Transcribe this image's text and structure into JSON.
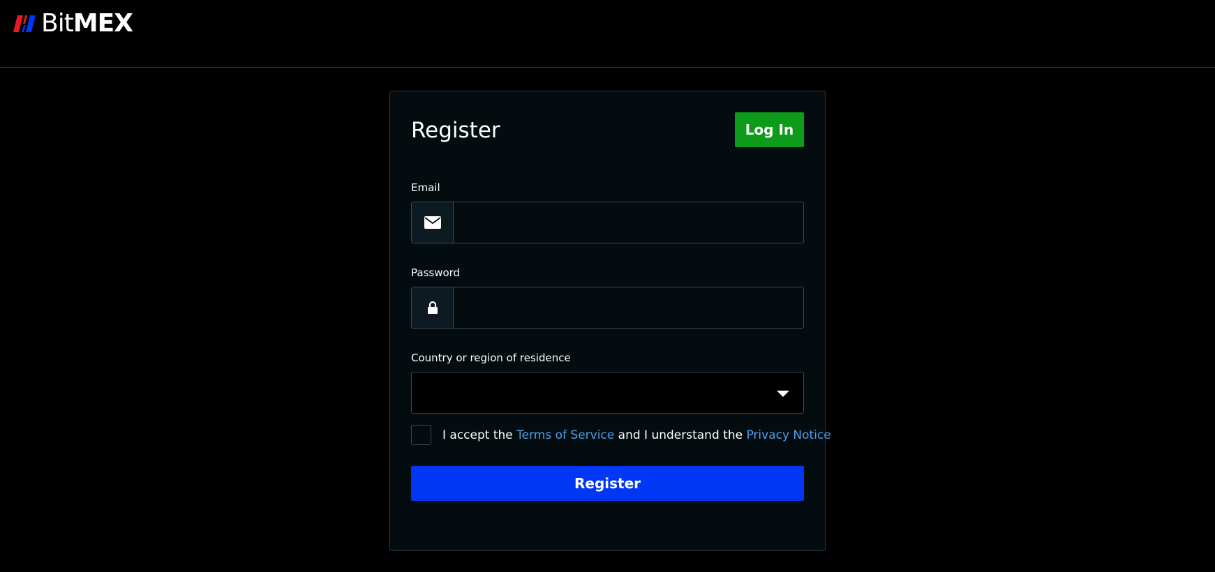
{
  "header": {
    "logo_text_light": "Bit",
    "logo_text_bold": "MEX",
    "logo_colors": {
      "red": "#e31b23",
      "blue": "#0037f5"
    }
  },
  "register_form": {
    "title": "Register",
    "login_button_label": "Log In",
    "email": {
      "label": "Email",
      "value": "",
      "placeholder": "",
      "icon": "envelope-icon"
    },
    "password": {
      "label": "Password",
      "value": "",
      "placeholder": "",
      "icon": "lock-icon"
    },
    "country": {
      "label": "Country or region of residence",
      "selected": ""
    },
    "terms": {
      "checked": false,
      "text_before": "I accept the ",
      "terms_link": "Terms of Service",
      "text_middle": " and I understand the ",
      "privacy_link": "Privacy Notice"
    },
    "submit_label": "Register"
  },
  "colors": {
    "background": "#000000",
    "card": "#050c10",
    "login_green": "#0e9a1a",
    "register_blue": "#0037f5",
    "link_blue": "#4f9fe8"
  }
}
